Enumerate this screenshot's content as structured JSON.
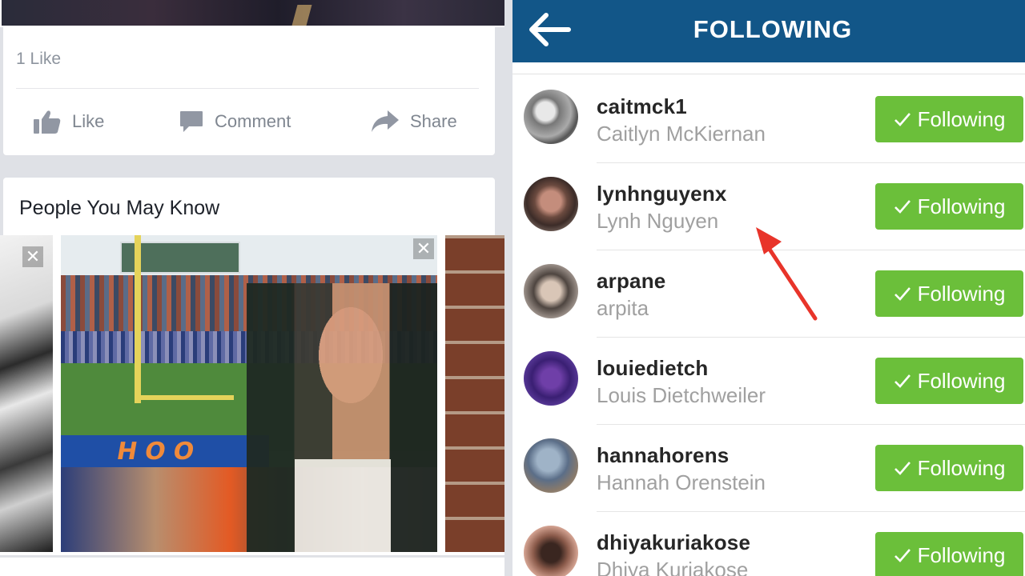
{
  "feed": {
    "likes_count": "1 Like",
    "actions": {
      "like": "Like",
      "comment": "Comment",
      "share": "Share"
    },
    "people_you_may_know": {
      "title": "People You May Know"
    }
  },
  "following_screen": {
    "title": "FOLLOWING",
    "accent_color": "#125688",
    "button_color": "#6bbf3a",
    "users": [
      {
        "username": "caitmck1",
        "full_name": "Caitlyn McKiernan",
        "button": "Following"
      },
      {
        "username": "lynhnguyenx",
        "full_name": "Lynh Nguyen",
        "button": "Following"
      },
      {
        "username": "arpane",
        "full_name": "arpita",
        "button": "Following"
      },
      {
        "username": "louiedietch",
        "full_name": "Louis Dietchweiler",
        "button": "Following"
      },
      {
        "username": "hannahorens",
        "full_name": "Hannah Orenstein",
        "button": "Following"
      },
      {
        "username": "dhiyakuriakose",
        "full_name": "Dhiya Kuriakose",
        "button": "Following"
      }
    ]
  },
  "annotation": {
    "color": "#e8342a",
    "icon": "red-arrow-icon"
  }
}
